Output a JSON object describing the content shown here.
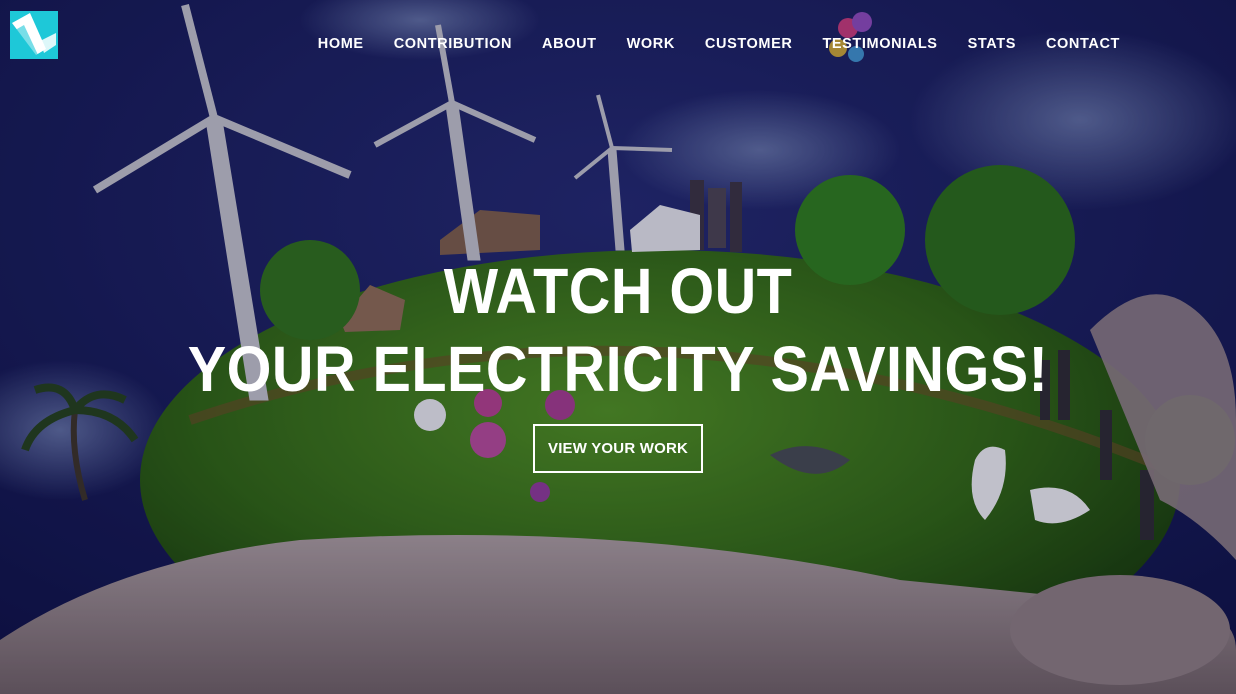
{
  "nav": {
    "items": [
      {
        "label": "HOME"
      },
      {
        "label": "CONTRIBUTION"
      },
      {
        "label": "ABOUT"
      },
      {
        "label": "WORK"
      },
      {
        "label": "CUSTOMER"
      },
      {
        "label": "TESTIMONIALS"
      },
      {
        "label": "STATS"
      },
      {
        "label": "CONTACT"
      }
    ]
  },
  "hero": {
    "line1": "WATCH OUT",
    "line2": "YOUR ELECTRICITY SAVINGS!",
    "cta_label": "VIEW YOUR WORK",
    "background": "hand-holding-green-earth-with-wind-turbines"
  },
  "colors": {
    "logo_accent": "#1ec8d8",
    "sky": "#141650",
    "grass": "#4a8a1e",
    "text": "#ffffff"
  },
  "icons": {
    "logo": "logo-icon"
  }
}
